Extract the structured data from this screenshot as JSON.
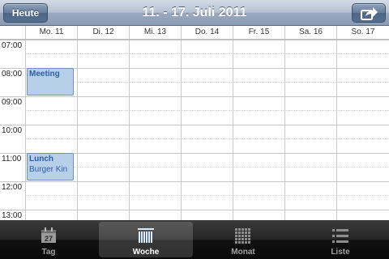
{
  "header": {
    "title": "11. - 17. Juli 2011",
    "today_label": "Heute",
    "share_icon": "share-arrow-icon"
  },
  "days": [
    {
      "label": "Mo. 11"
    },
    {
      "label": "Di. 12"
    },
    {
      "label": "Mi. 13"
    },
    {
      "label": "Do. 14"
    },
    {
      "label": "Fr. 15"
    },
    {
      "label": "Sa. 16"
    },
    {
      "label": "So. 17"
    }
  ],
  "hours": [
    "07:00",
    "08:00",
    "09:00",
    "10:00",
    "11:00",
    "12:00",
    "13:00"
  ],
  "events": [
    {
      "title": "Meeting",
      "location": "",
      "day": "Mo. 11",
      "start": "08:00",
      "end": "09:00"
    },
    {
      "title": "Lunch",
      "location": "Burger Kin",
      "day": "Mo. 11",
      "start": "11:00",
      "end": "12:00"
    }
  ],
  "tabs": [
    {
      "label": "Tag",
      "icon": "calendar-day-icon",
      "day_number": "27",
      "active": false
    },
    {
      "label": "Woche",
      "icon": "week-columns-icon",
      "active": true
    },
    {
      "label": "Monat",
      "icon": "month-grid-icon",
      "active": false
    },
    {
      "label": "Liste",
      "icon": "list-icon",
      "active": false
    }
  ],
  "colors": {
    "event_fill": "#b8cfe9",
    "event_border": "#6c92c4",
    "event_text": "#2a5fa8",
    "toolbar": "#8a9cb3"
  }
}
